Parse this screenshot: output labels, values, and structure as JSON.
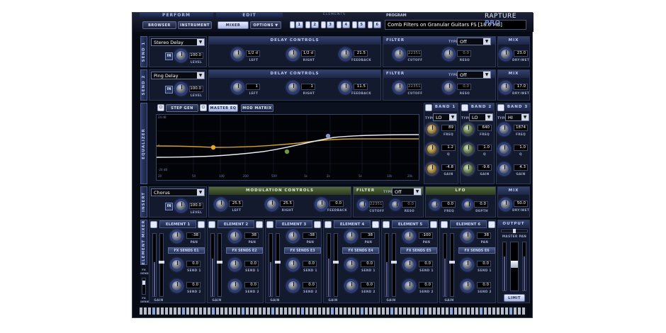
{
  "header": {
    "perform": "PERFORM",
    "edit": "EDIT",
    "elements": "ELEMENTS",
    "program": "PROGRAM",
    "browser": "BROWSER",
    "instrument": "INSTRUMENT",
    "mixer": "MIXER",
    "options": "OPTIONS ▼",
    "element_nums": [
      "1",
      "2",
      "3",
      "4",
      "5",
      "6"
    ],
    "program_name": "Comb Filters on Granular Guitars FS [18.6 MB]",
    "logo_main": "RAPTURE",
    "logo_pro": "PRO"
  },
  "send1": {
    "label": "SEND 1",
    "effect": "Stereo Delay",
    "in": "IN",
    "level": "100.0",
    "level_lbl": "LEVEL",
    "delay_title": "DELAY CONTROLS",
    "left": "1/2 d",
    "left_lbl": "LEFT",
    "right": "1/2 d",
    "right_lbl": "RIGHT",
    "feedback": "21.5",
    "feedback_lbl": "FEEDBACK",
    "filter_title": "FILTER",
    "type_lbl": "TYPE",
    "type": "Off",
    "cutoff": "22351",
    "cutoff_lbl": "CUTOFF",
    "reso": "0.0",
    "reso_lbl": "RESO",
    "mix_title": "MIX",
    "mix": "23.0",
    "mix_lbl": "DRY/WET"
  },
  "send2": {
    "label": "SEND 2",
    "effect": "Ping Delay",
    "in": "IN",
    "level": "100.0",
    "level_lbl": "LEVEL",
    "delay_title": "DELAY CONTROLS",
    "left": "1",
    "left_lbl": "LEFT",
    "right": "1",
    "right_lbl": "RIGHT",
    "feedback": "11.5",
    "feedback_lbl": "FEEDBACK",
    "filter_title": "FILTER",
    "type_lbl": "TYPE",
    "type": "Off",
    "cutoff": "22351",
    "cutoff_lbl": "CUTOFF",
    "reso": "0.0",
    "reso_lbl": "RESO",
    "mix_title": "MIX",
    "mix": "17.0",
    "mix_lbl": "DRY/WET"
  },
  "eq": {
    "label": "EQUALIZER",
    "step_gen": "STEP GEN",
    "master_eq": "MASTER EQ",
    "mod_matrix": "MOD MATRIX",
    "db_top": "24 dB",
    "db_mid": "0",
    "db_bot": "-24 dB",
    "freqs": [
      "20",
      "50",
      "100",
      "200",
      "500",
      "1k",
      "2k",
      "5k",
      "10k",
      "20k"
    ],
    "bands": [
      {
        "title": "BAND 1",
        "type": "LO",
        "freq": "89",
        "q": "1.2",
        "gain": "-4.8"
      },
      {
        "title": "BAND 2",
        "type": "LO",
        "freq": "640",
        "q": "1.0",
        "gain": "-9.6"
      },
      {
        "title": "BAND 3",
        "type": "HI",
        "freq": "1874",
        "q": "1.0",
        "gain": "4.3"
      }
    ],
    "type_lbl": "TYPE",
    "freq_lbl": "FREQ",
    "q_lbl": "Q",
    "gain_lbl": "GAIN"
  },
  "insert": {
    "label": "INSERT",
    "effect": "Chorus",
    "in": "IN",
    "level": "100.0",
    "level_lbl": "LEVEL",
    "mod_title": "MODULATION CONTROLS",
    "left": "25.5",
    "left_lbl": "LEFT",
    "right": "25.5",
    "right_lbl": "RIGHT",
    "feedback": "0.0",
    "feedback_lbl": "FEEDBACK",
    "filter_title": "FILTER",
    "type_lbl": "TYPE",
    "type": "Off",
    "cutoff": "22351",
    "cutoff_lbl": "CUTOFF",
    "reso": "0.0",
    "reso_lbl": "RESO",
    "lfo_title": "LFO",
    "freq": "0.0",
    "freq_lbl": "FREQ",
    "depth": "0.0",
    "depth_lbl": "DEPTH",
    "mix_title": "MIX",
    "mix": "50.0",
    "mix_lbl": "DRY/WET"
  },
  "mixer": {
    "label": "ELEMENT MIXER",
    "fx_send": "FX SEND",
    "fx_series": "FX SERIES",
    "pan_lbl": "PAN",
    "gain_lbl": "GAIN",
    "send1_lbl": "SEND 1",
    "send2_lbl": "SEND 2",
    "elements": [
      {
        "title": "ELEMENT 1",
        "pan": "-38",
        "fx": "FX SENDS E1",
        "s1": "0.0",
        "s2": "0.0"
      },
      {
        "title": "ELEMENT 2",
        "pan": "38",
        "fx": "FX SENDS E2",
        "s1": "0.0",
        "s2": "0.0"
      },
      {
        "title": "ELEMENT 3",
        "pan": "-38",
        "fx": "FX SENDS E3",
        "s1": "0.0",
        "s2": "0.0"
      },
      {
        "title": "ELEMENT 4",
        "pan": "38",
        "fx": "FX SENDS E4",
        "s1": "0.0",
        "s2": "0.0"
      },
      {
        "title": "ELEMENT 5",
        "pan": "-100",
        "fx": "FX SENDS E5",
        "s1": "0.0",
        "s2": "0.0"
      },
      {
        "title": "ELEMENT 6",
        "pan": "38",
        "fx": "FX SENDS E6",
        "s1": "0.0",
        "s2": "0.0"
      }
    ],
    "output": "OUTPUT",
    "master_pan": "MASTER PAN",
    "limit": "LIMIT"
  }
}
